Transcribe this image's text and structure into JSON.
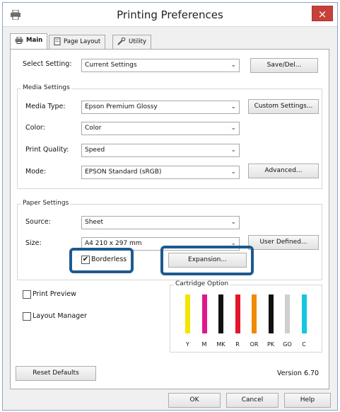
{
  "window": {
    "title": "Printing Preferences",
    "close_glyph": "×"
  },
  "tabs": [
    {
      "label": "Main",
      "icon": "printer-icon"
    },
    {
      "label": "Page Layout",
      "icon": "page-icon"
    },
    {
      "label": "Utility",
      "icon": "wrench-icon"
    }
  ],
  "select_setting": {
    "label": "Select Setting:",
    "value": "Current Settings",
    "button": "Save/Del..."
  },
  "media_settings": {
    "group_label": "Media Settings",
    "media_type": {
      "label": "Media Type:",
      "value": "Epson Premium Glossy",
      "button": "Custom Settings..."
    },
    "color": {
      "label": "Color:",
      "value": "Color"
    },
    "print_quality": {
      "label": "Print Quality:",
      "value": "Speed"
    },
    "mode": {
      "label": "Mode:",
      "value": "EPSON Standard (sRGB)",
      "button": "Advanced..."
    }
  },
  "paper_settings": {
    "group_label": "Paper Settings",
    "source": {
      "label": "Source:",
      "value": "Sheet"
    },
    "size": {
      "label": "Size:",
      "value": "A4 210 x 297 mm",
      "button": "User Defined..."
    },
    "borderless": {
      "label": "Borderless",
      "checked": true
    },
    "expansion_button": "Expansion..."
  },
  "print_preview": {
    "label": "Print Preview",
    "checked": false
  },
  "layout_manager": {
    "label": "Layout Manager",
    "checked": false
  },
  "cartridge_option": {
    "label": "Cartridge Option",
    "inks": [
      {
        "code": "Y",
        "color": "#f2e600"
      },
      {
        "code": "M",
        "color": "#e0188c"
      },
      {
        "code": "MK",
        "color": "#111111"
      },
      {
        "code": "R",
        "color": "#e3162b"
      },
      {
        "code": "OR",
        "color": "#f08a00"
      },
      {
        "code": "PK",
        "color": "#111111"
      },
      {
        "code": "GO",
        "color": "#cfcfcf"
      },
      {
        "code": "C",
        "color": "#15c6e0"
      }
    ]
  },
  "reset_defaults": "Reset Defaults",
  "version": "Version 6.70",
  "footer": {
    "ok": "OK",
    "cancel": "Cancel",
    "help": "Help"
  },
  "colors": {
    "highlight": "#1d5a8f",
    "close": "#c8403a"
  }
}
